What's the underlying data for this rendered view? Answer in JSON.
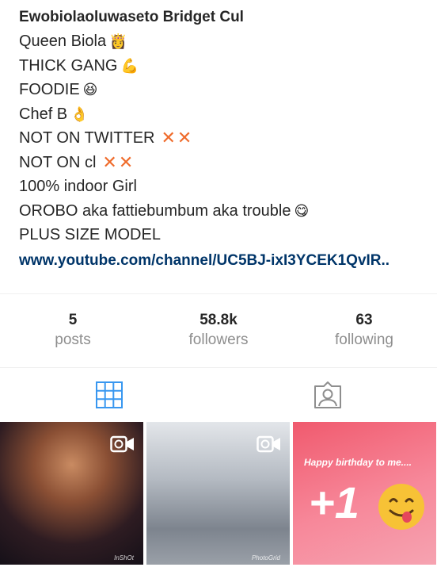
{
  "profile": {
    "name": "Ewobiolaoluwaseto Bridget Cul",
    "bio_lines": [
      {
        "text": "Queen Biola",
        "emoji": "princess-emoji"
      },
      {
        "text": "THICK GANG",
        "emoji": "flexed-biceps-emoji"
      },
      {
        "text": "FOODIE",
        "emoji": "grinning-squinting-face-emoji"
      },
      {
        "text": "Chef B",
        "emoji": "ok-hand-emoji"
      },
      {
        "text": "NOT ON TWITTER",
        "emoji": "cross-mark-emoji"
      },
      {
        "text": "NOT ON cl",
        "emoji": "cross-mark-emoji"
      },
      {
        "text": "100% indoor Girl",
        "emoji": ""
      },
      {
        "text": "OROBO aka fattiebumbum aka trouble",
        "emoji": "face-savoring-food-emoji"
      },
      {
        "text": "PLUS SIZE MODEL",
        "emoji": ""
      }
    ],
    "link": "www.youtube.com/channel/UC5BJ-ixI3YCEK1QvIR.."
  },
  "stats": {
    "posts": {
      "count": "5",
      "label": "posts"
    },
    "followers": {
      "count": "58.8k",
      "label": "followers"
    },
    "following": {
      "count": "63",
      "label": "following"
    }
  },
  "tabs": {
    "grid_icon": "grid-icon",
    "tagged_icon": "tagged-person-icon"
  },
  "posts": [
    {
      "type": "video",
      "watermark": "InShOt"
    },
    {
      "type": "video",
      "watermark": "PhotoGrid"
    },
    {
      "type": "image",
      "caption": "Happy birthday to me....",
      "big_text": "+1"
    }
  ],
  "colors": {
    "link": "#003569",
    "accent": "#3897f0",
    "cross": "#ef6b2b",
    "muted": "#8e8e8e"
  }
}
